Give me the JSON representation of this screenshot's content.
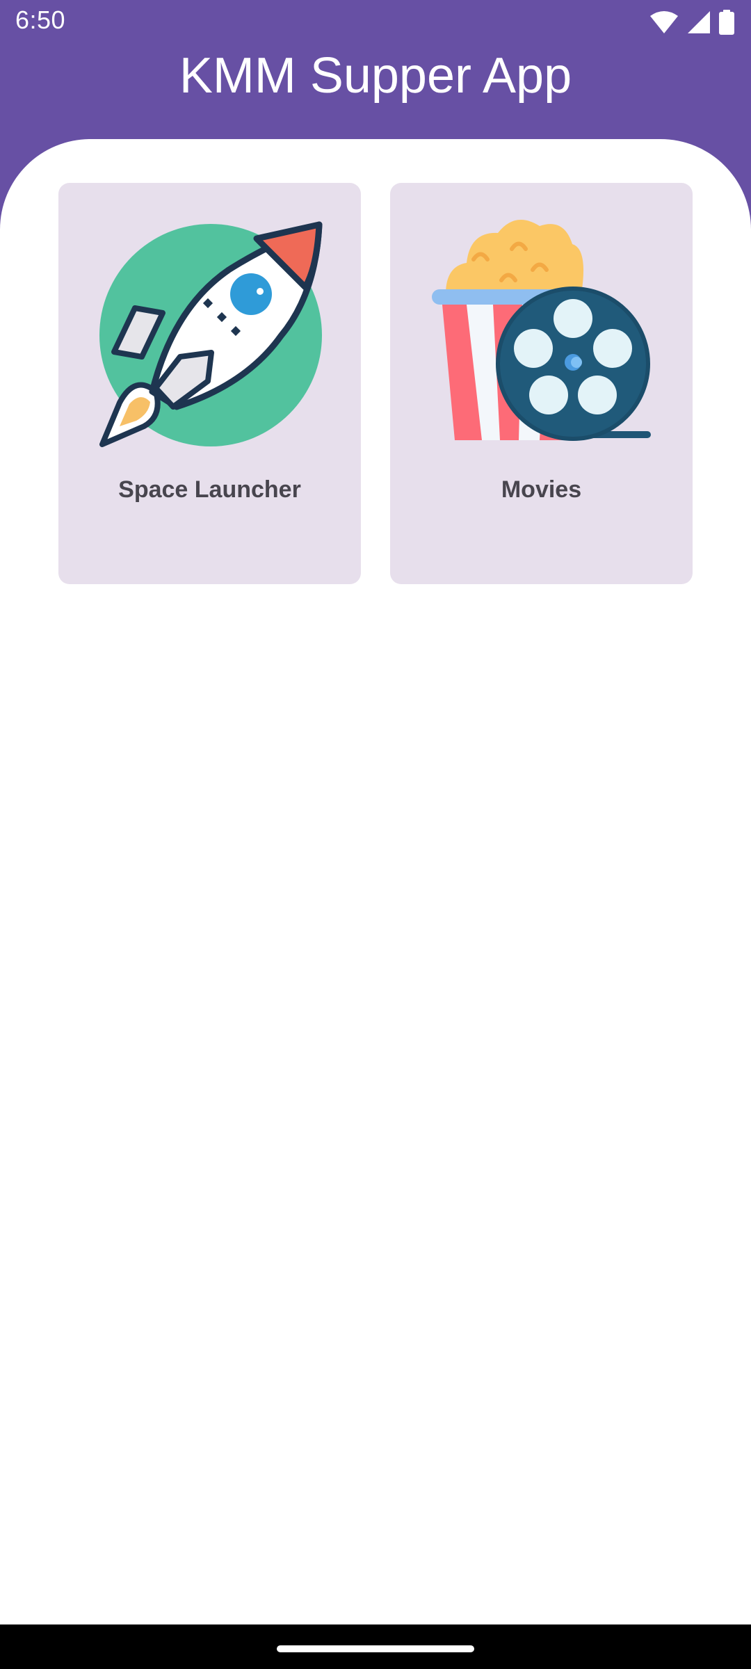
{
  "status_bar": {
    "time": "6:50",
    "icons": [
      "wifi-icon",
      "cell-signal-icon",
      "battery-icon"
    ]
  },
  "app_bar": {
    "title": "KMM Supper App",
    "color": "#6750A4"
  },
  "features": [
    {
      "label": "Space Launcher",
      "icon": "rocket-icon"
    },
    {
      "label": "Movies",
      "icon": "popcorn-film-reel-icon"
    }
  ],
  "colors": {
    "card_background": "#E7DFEC",
    "card_text": "#48454E"
  }
}
